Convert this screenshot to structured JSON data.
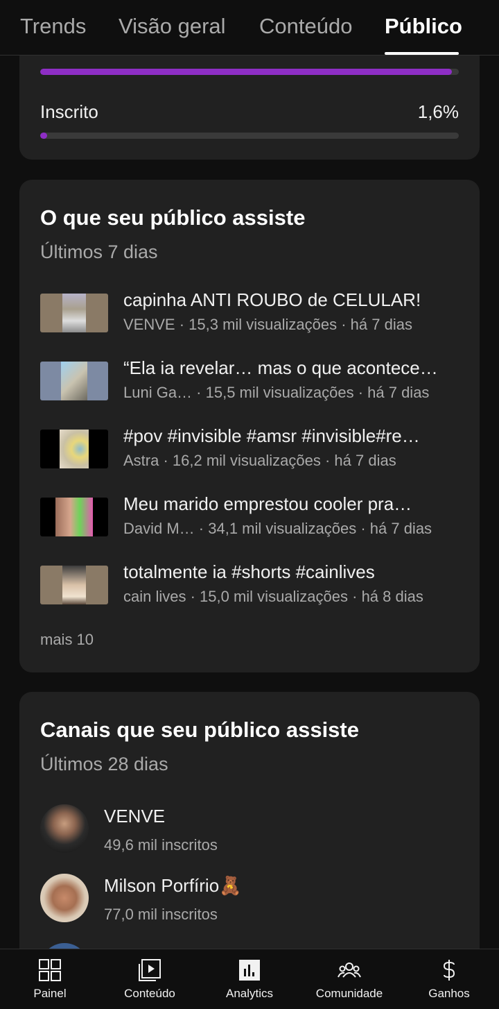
{
  "tabs": [
    {
      "label": "Trends",
      "active": false
    },
    {
      "label": "Visão geral",
      "active": false
    },
    {
      "label": "Conteúdo",
      "active": false
    },
    {
      "label": "Público",
      "active": true
    }
  ],
  "audience_bars": {
    "top_bar": {
      "fill_percent": 98.4
    },
    "subscribed": {
      "label": "Inscrito",
      "value": "1,6%",
      "fill_percent": 1.6
    }
  },
  "watch": {
    "title": "O que seu público assiste",
    "subtitle": "Últimos 7 dias",
    "videos": [
      {
        "title": "capinha ANTI ROUBO de CELULAR!",
        "meta": "VENVE · 15,3 mil visualizações · há 7 dias"
      },
      {
        "title": "“Ela ia revelar… mas o que acontece…",
        "meta": "Luni Ga…   · 15,5 mil visualizações · há 7 dias"
      },
      {
        "title": "#pov #invisible #amsr  #invisible#re…",
        "meta": "Astra · 16,2 mil visualizações · há 7 dias"
      },
      {
        "title": "Meu marido emprestou cooler pra…",
        "meta": "David M…   · 34,1 mil visualizações · há 7 dias"
      },
      {
        "title": "totalmente ia #shorts #cainlives",
        "meta": "cain lives · 15,0 mil visualizações · há 8 dias"
      }
    ],
    "more": "mais 10"
  },
  "channels": {
    "title": "Canais que seu público assiste",
    "subtitle": "Últimos 28 dias",
    "items": [
      {
        "name": "VENVE",
        "subs": "49,6 mil inscritos"
      },
      {
        "name": "Milson Porfírio🧸",
        "subs": "77,0 mil inscritos"
      }
    ]
  },
  "nav": [
    {
      "label": "Painel",
      "icon": "dashboard-icon"
    },
    {
      "label": "Conteúdo",
      "icon": "content-icon"
    },
    {
      "label": "Analytics",
      "icon": "analytics-icon"
    },
    {
      "label": "Comunidade",
      "icon": "community-icon"
    },
    {
      "label": "Ganhos",
      "icon": "dollar-icon"
    }
  ],
  "colors": {
    "accent": "#8e2ec5",
    "background": "#0f0f0f",
    "card": "#212121"
  }
}
